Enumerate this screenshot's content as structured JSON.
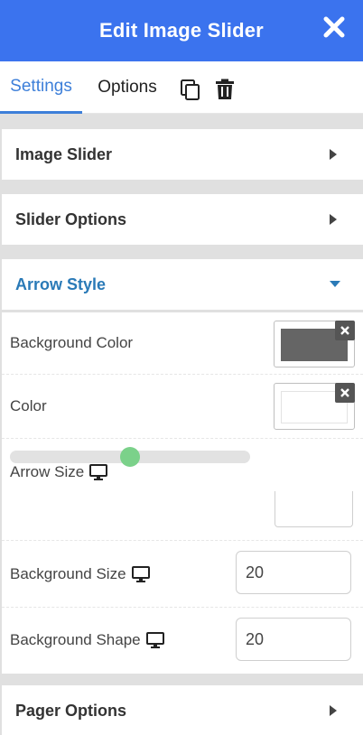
{
  "header": {
    "title": "Edit Image Slider",
    "close_icon": "close-icon"
  },
  "tabs": {
    "settings": "Settings",
    "options": "Options",
    "duplicate_icon": "copy-icon",
    "delete_icon": "trash-icon",
    "active_color": "#3d7fd9"
  },
  "sections": {
    "image_slider": "Image Slider",
    "slider_options": "Slider Options",
    "arrow_style": "Arrow Style",
    "pager_options": "Pager Options"
  },
  "arrow_style": {
    "background_color": {
      "label": "Background Color",
      "value": "#656565"
    },
    "color": {
      "label": "Color",
      "value": "#ffffff"
    },
    "arrow_size": {
      "label": "Arrow Size",
      "level": 0.5,
      "value": ""
    },
    "background_size": {
      "label": "Background Size",
      "value": "20"
    },
    "background_shape": {
      "label": "Background Shape",
      "value": "20"
    }
  },
  "colors": {
    "header_bg": "#3b73ee",
    "section_active": "#2a7ab7",
    "slider_thumb": "#7bd18a"
  }
}
